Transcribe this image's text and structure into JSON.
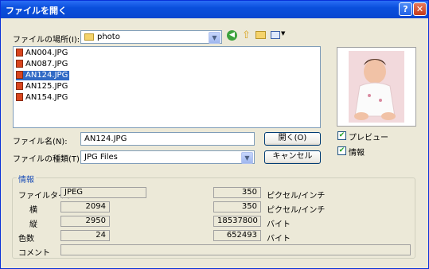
{
  "window": {
    "title": "ファイルを開く",
    "help_glyph": "?",
    "close_glyph": "✕"
  },
  "location": {
    "label": "ファイルの場所(I):",
    "value": "photo"
  },
  "files": [
    "AN004.JPG",
    "AN087.JPG",
    "AN124.JPG",
    "AN125.JPG",
    "AN154.JPG"
  ],
  "selected_file": "AN124.JPG",
  "filename": {
    "label": "ファイル名(N):",
    "value": "AN124.JPG"
  },
  "filetype": {
    "label": "ファイルの種類(T):",
    "value": "JPG Files"
  },
  "buttons": {
    "open": "開く(O)",
    "cancel": "キャンセル"
  },
  "options": {
    "preview": "プレビュー",
    "info": "情報"
  },
  "info": {
    "group_label": "情報",
    "filetype_label": "ファイルタイプ",
    "filetype_value": "JPEG",
    "width_label": "横",
    "width_value": "2094",
    "height_label": "縦",
    "height_value": "2950",
    "colors_label": "色数",
    "colors_value": "24",
    "comment_label": "コメント",
    "comment_value": "",
    "dpi_x_value": "350",
    "dpi_x_unit": "ピクセル/インチ",
    "dpi_y_value": "350",
    "dpi_y_unit": "ピクセル/インチ",
    "size_value": "18537800",
    "size_unit": "バイト",
    "compressed_value": "652493",
    "compressed_unit": "バイト"
  }
}
